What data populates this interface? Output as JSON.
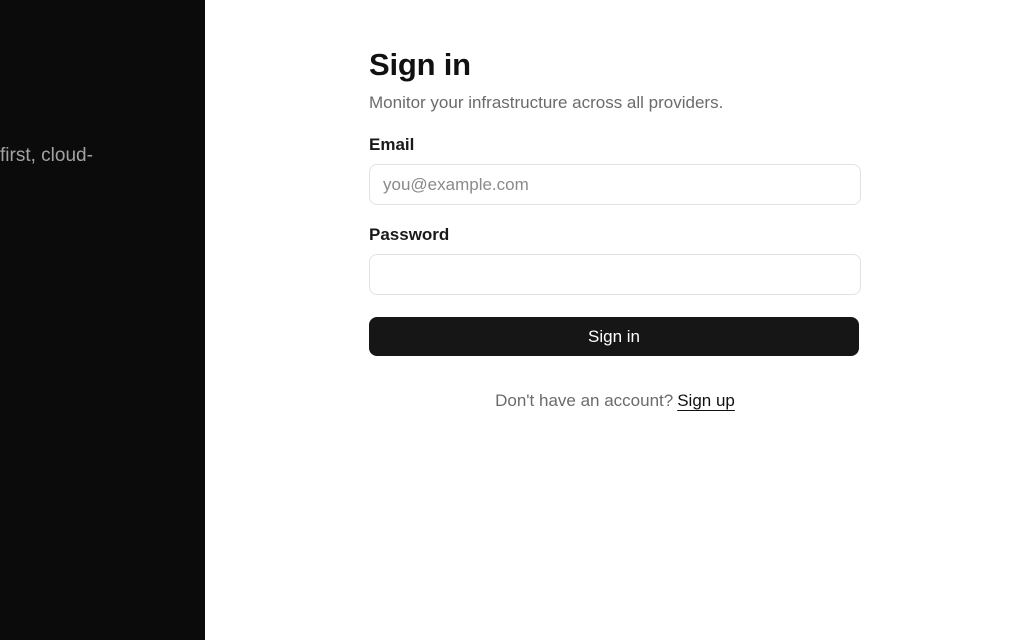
{
  "left_panel": {
    "tagline": "first, cloud-"
  },
  "form": {
    "title": "Sign in",
    "subtitle": "Monitor your infrastructure across all providers.",
    "email": {
      "label": "Email",
      "placeholder": "you@example.com",
      "value": ""
    },
    "password": {
      "label": "Password",
      "placeholder": "",
      "value": ""
    },
    "submit_label": "Sign in",
    "signup_prompt": "Don't have an account?",
    "signup_link": "Sign up"
  }
}
